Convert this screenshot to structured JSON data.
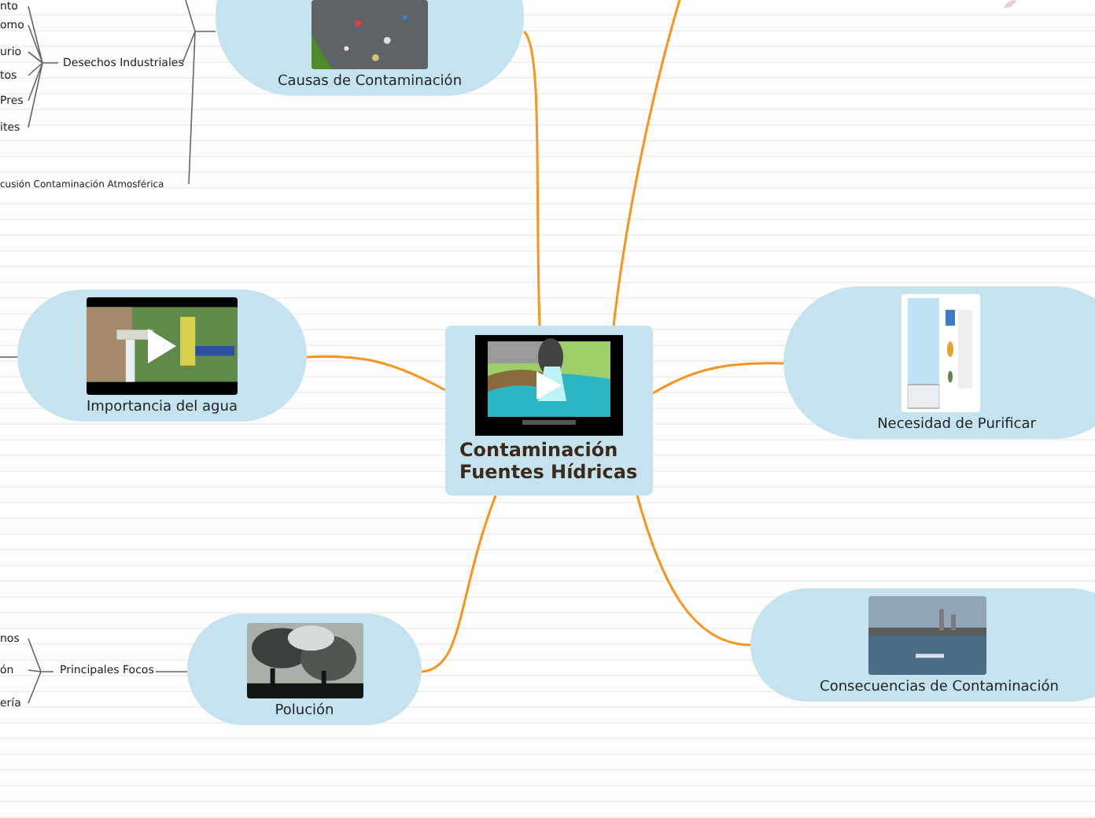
{
  "central": {
    "title_lines": [
      "Contaminación",
      "Fuentes Hídricas"
    ],
    "kind": "video"
  },
  "topics": [
    {
      "label": "Causas de Contaminación",
      "kind": "picture"
    },
    {
      "label": "Importancia del agua",
      "kind": "video"
    },
    {
      "label": "Necesidad de Purificar",
      "kind": "picture"
    },
    {
      "label": "Polución",
      "kind": "picture"
    },
    {
      "label": "Consecuencias de Contaminación",
      "kind": "picture"
    }
  ],
  "causes_branch": {
    "group": "Desechos Industriales",
    "items": [
      "nto",
      "omo",
      "urio",
      "tos",
      "Pres",
      "ites"
    ],
    "other": "cusión Contaminación Atmosférica"
  },
  "pollution_branch": {
    "group": "Principales Focos",
    "items": [
      "nos",
      "ón",
      "ería"
    ]
  }
}
